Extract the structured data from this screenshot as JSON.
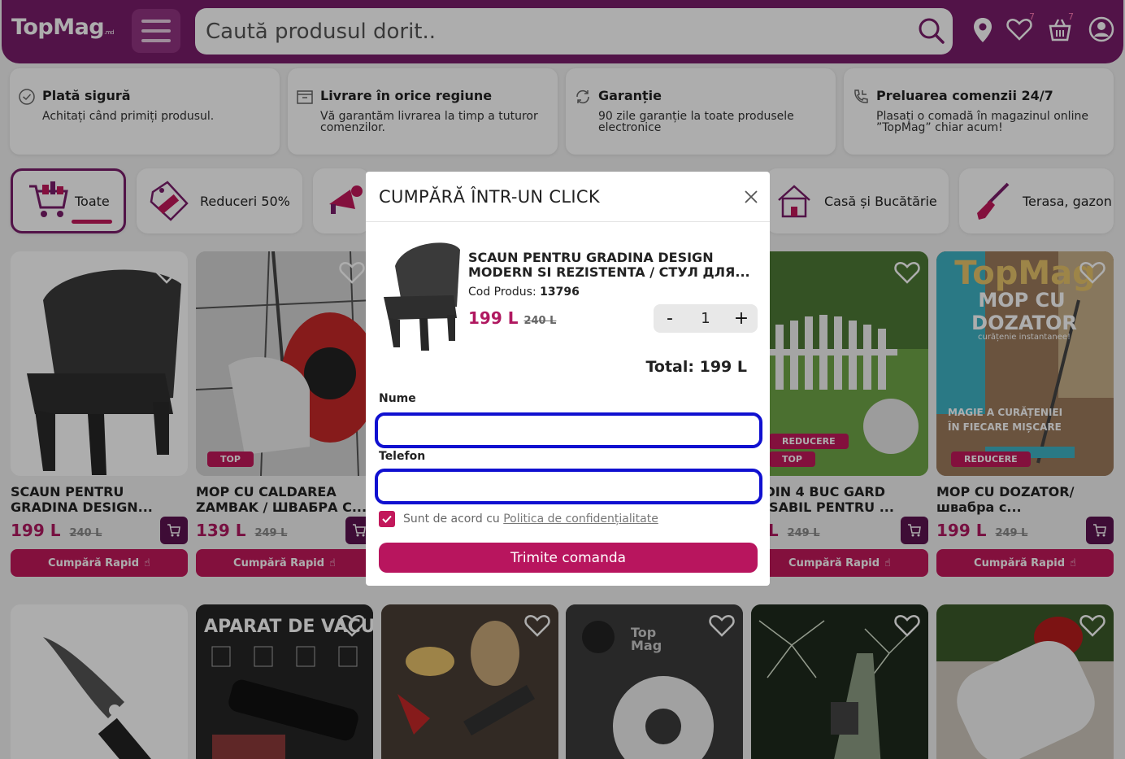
{
  "header": {
    "logo": "TopMag",
    "logo_suffix": ".md",
    "search_placeholder": "Caută produsul dorit..",
    "wishlist_count": "7",
    "cart_count": "7"
  },
  "features": [
    {
      "title": "Plată sigură",
      "desc": "Achitați când primiți produsul.",
      "icon": "check-circle-icon"
    },
    {
      "title": "Livrare în orice regiune",
      "desc": "Vă garantăm livrarea la timp a tuturor comenzilor.",
      "icon": "box-icon"
    },
    {
      "title": "Garanție",
      "desc": "90 zile garanție la toate produsele electronice",
      "icon": "refresh-icon"
    },
    {
      "title": "Preluarea comenzii 24/7",
      "desc": "Plasați o comadă în magazinul online ”TopMag” chiar acum!",
      "icon": "phone-icon"
    }
  ],
  "categories": [
    {
      "label": "Toate",
      "active": true
    },
    {
      "label": "Reduceri 50%"
    },
    {
      "label": "Casă și Bucătărie"
    },
    {
      "label": "Terasa, gazon"
    }
  ],
  "products_row1": [
    {
      "title": "SCAUN PENTRU GRADINA DESIGN...",
      "price": "199 L",
      "old": "240 L",
      "btn": "Cumpără Rapid"
    },
    {
      "title": "MOP CU CALDAREA ZAMBAK / ШВАБРА С...",
      "price": "139 L",
      "old": "249 L",
      "btn": "Cumpără Rapid",
      "tag": "TOP"
    },
    {
      "title": "T DIN 4 BUC GARD TASABIL PENTRU ...",
      "price": "9 L",
      "old": "249 L",
      "btn": "Cumpără Rapid",
      "tag": "TOP",
      "tag2": "REDUCERE"
    },
    {
      "title": "MOP CU DOZATOR/ швабра с...",
      "price": "199 L",
      "old": "249 L",
      "btn": "Cumpără Rapid",
      "tag2": "REDUCERE"
    }
  ],
  "mop_image_text": {
    "brand": "TopMag",
    "line1": "MOP CU",
    "line2": "DOZATOR",
    "line3": "curățenie instantanee!",
    "line4": "MAGIE A CURĂȚENIEI",
    "line5": "ÎN FIECARE MIȘCARE"
  },
  "vacuum_image_text": "APARAT DE VACUU",
  "modal": {
    "title": "CUMPĂRĂ ÎNTR-UN CLICK",
    "product_name": "SCAUN PENTRU GRADINA DESIGN MODERN SI REZISTENTA / СТУЛ ДЛЯ...",
    "code_label": "Cod Produs:",
    "code": "13796",
    "price": "199 L",
    "old_price": "240 L",
    "qty": "1",
    "qty_minus": "-",
    "qty_plus": "+",
    "total": "Total: 199 L",
    "name_label": "Nume",
    "phone_label": "Telefon",
    "agree_text": "Sunt de acord cu",
    "agree_link": "Politica de confidențialitate",
    "submit": "Trimite comanda"
  }
}
